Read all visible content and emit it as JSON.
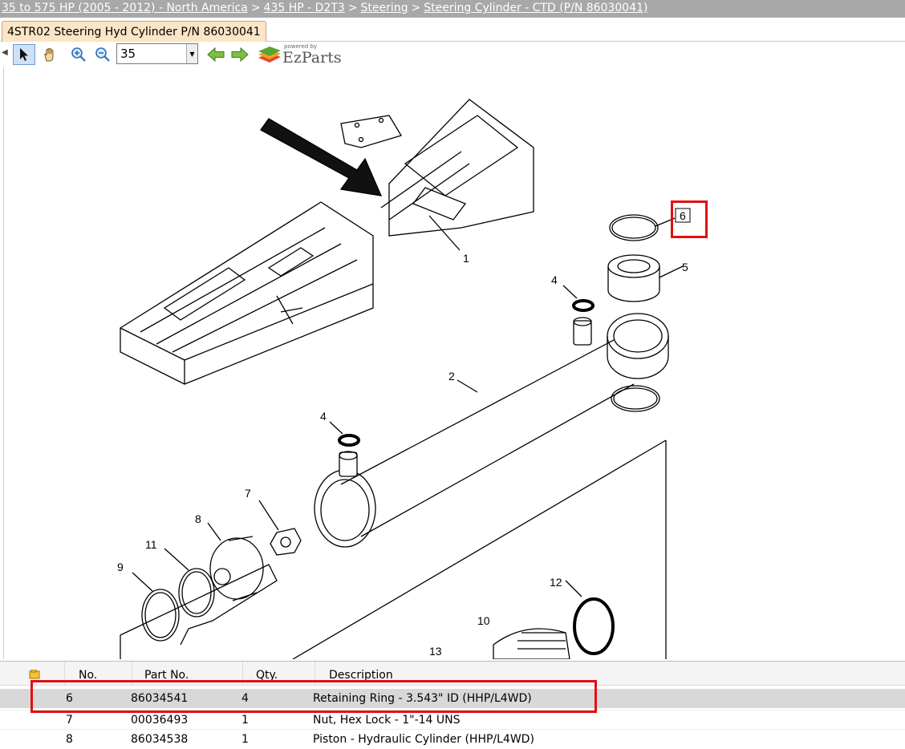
{
  "breadcrumb": {
    "items": [
      "35 to 575 HP (2005 - 2012) - North America",
      "435 HP - D2T3",
      "Steering",
      "Steering Cylinder - CTD (P/N 86030041)"
    ],
    "separator": ">"
  },
  "tab": {
    "label": "4STR02 Steering Hyd Cylinder P/N 86030041"
  },
  "toolbar": {
    "zoom_value": "35",
    "logo_powered": "powered by",
    "logo_name": "EzParts"
  },
  "drawing": {
    "callouts": [
      "1",
      "2",
      "4",
      "4",
      "5",
      "6",
      "7",
      "8",
      "9",
      "10",
      "11",
      "12",
      "13"
    ]
  },
  "table": {
    "headers": [
      "No.",
      "Part No.",
      "Qty.",
      "Description"
    ],
    "rows": [
      {
        "no": "6",
        "part": "86034541",
        "qty": "4",
        "desc": "Retaining Ring - 3.543\" ID (HHP/L4WD)"
      },
      {
        "no": "7",
        "part": "00036493",
        "qty": "1",
        "desc": "Nut, Hex Lock - 1\"-14 UNS"
      },
      {
        "no": "8",
        "part": "86034538",
        "qty": "1",
        "desc": "Piston - Hydraulic Cylinder (HHP/L4WD)"
      }
    ]
  },
  "colors": {
    "highlight": "#e01010",
    "tab_bg": "#fbe5c6",
    "breadcrumb_bg": "#a8a8a8"
  }
}
